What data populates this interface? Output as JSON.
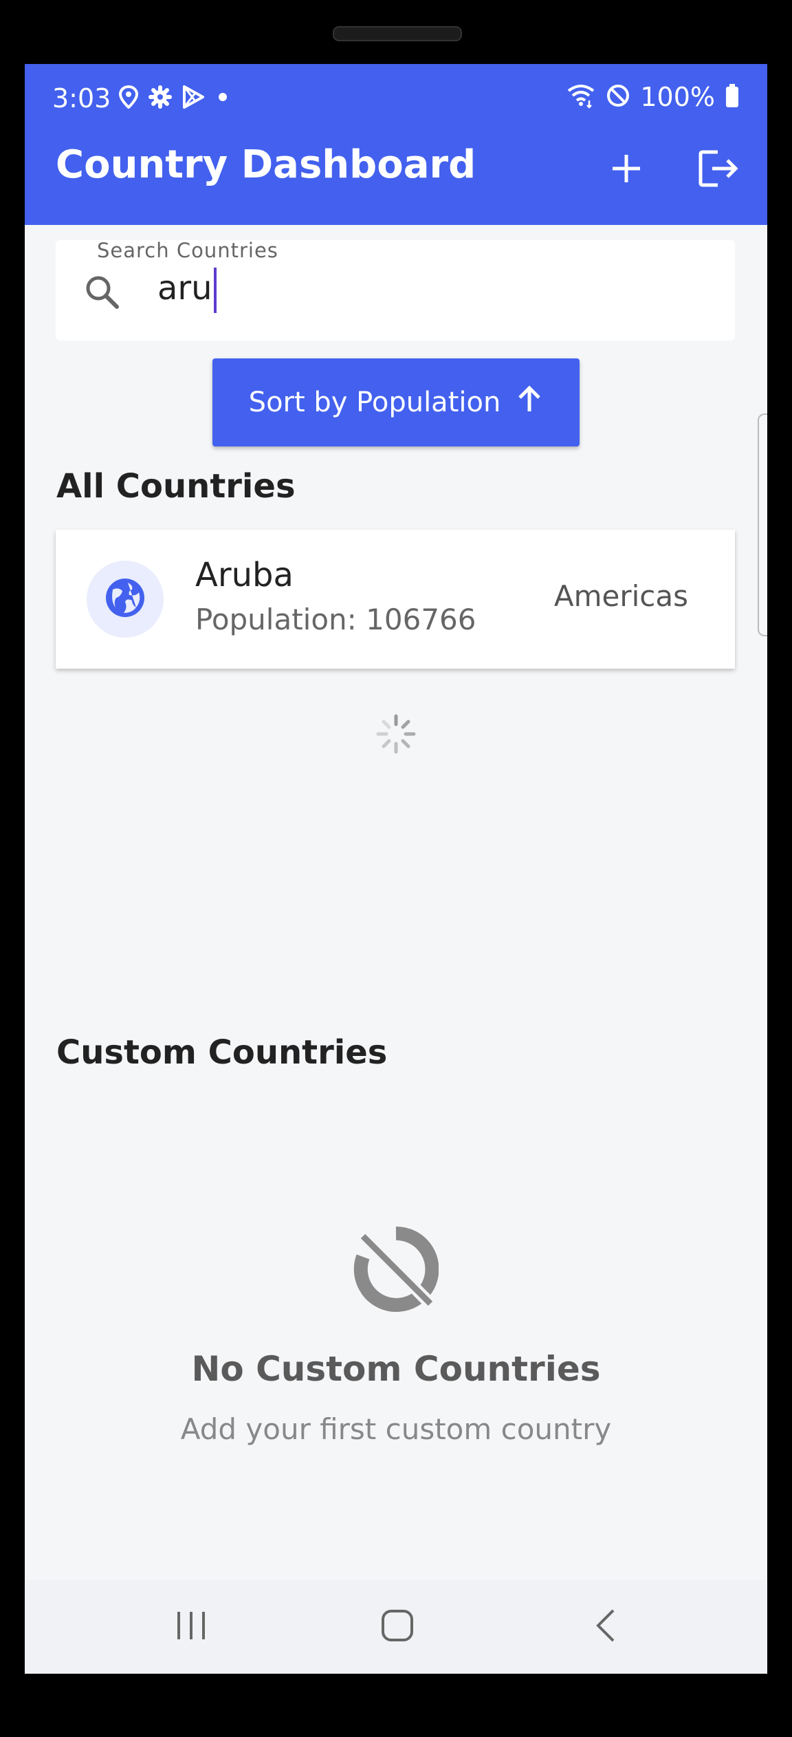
{
  "status_bar": {
    "time": "3:03",
    "battery": "100%",
    "icons_left": [
      "location-icon",
      "gear-icon",
      "play-store-icon",
      "dot-icon"
    ],
    "icons_right": [
      "wifi-icon",
      "do-not-disturb-icon",
      "battery-icon"
    ]
  },
  "app_bar": {
    "title": "Country Dashboard",
    "actions": [
      "add-icon",
      "logout-icon"
    ],
    "color": "#4361ee"
  },
  "search": {
    "label": "Search Countries",
    "value": "aru",
    "icon": "search-icon"
  },
  "sort_button": {
    "label": "Sort by Population",
    "icon": "arrow-up-icon"
  },
  "all_countries": {
    "title": "All Countries",
    "items": [
      {
        "name": "Aruba",
        "population": "Population: 106766",
        "region": "Americas",
        "icon": "globe-icon"
      }
    ]
  },
  "custom_countries": {
    "title": "Custom Countries",
    "empty_title": "No Custom Countries",
    "empty_subtitle": "Add your first custom country",
    "empty_icon": "sync-disabled-icon"
  },
  "nav_bar": {
    "buttons": [
      "recents-icon",
      "home-icon",
      "back-icon"
    ]
  }
}
